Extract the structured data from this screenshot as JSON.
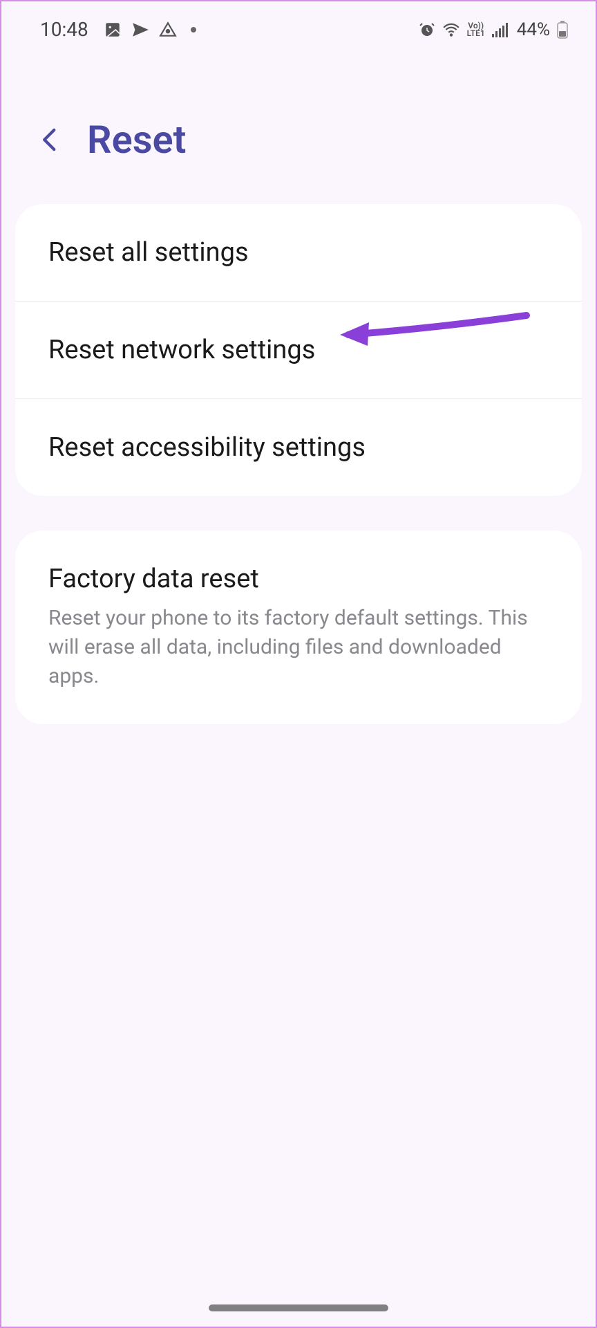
{
  "status_bar": {
    "time": "10:48",
    "battery_percent": "44%"
  },
  "header": {
    "title": "Reset"
  },
  "groups": [
    {
      "items": [
        {
          "label": "Reset all settings"
        },
        {
          "label": "Reset network settings",
          "highlighted": true
        },
        {
          "label": "Reset accessibility settings"
        }
      ]
    },
    {
      "items": [
        {
          "label": "Factory data reset",
          "subtitle": "Reset your phone to its factory default settings. This will erase all data, including files and downloaded apps."
        }
      ]
    }
  ]
}
